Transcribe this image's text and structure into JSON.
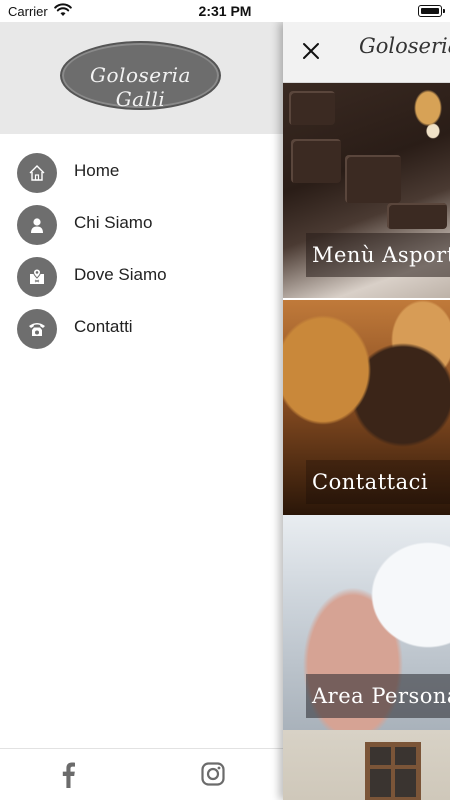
{
  "status_bar": {
    "carrier": "Carrier",
    "time": "2:31 PM"
  },
  "drawer": {
    "logo_text": "Goloseria Galli",
    "menu": [
      {
        "label": "Home",
        "icon": "home-icon"
      },
      {
        "label": "Chi Siamo",
        "icon": "person-icon"
      },
      {
        "label": "Dove Siamo",
        "icon": "map-icon"
      },
      {
        "label": "Contatti",
        "icon": "phone-icon"
      }
    ],
    "footer": [
      {
        "icon": "facebook-icon"
      },
      {
        "icon": "instagram-icon"
      }
    ]
  },
  "main": {
    "title": "Goloseria Galli",
    "tiles": [
      {
        "label": "Menù Asporto"
      },
      {
        "label": "Contattaci"
      },
      {
        "label": "Area Personale"
      },
      {
        "label": ""
      }
    ]
  },
  "colors": {
    "icon_circle": "#6e6e6e",
    "header_bg": "#e8e8e8"
  }
}
